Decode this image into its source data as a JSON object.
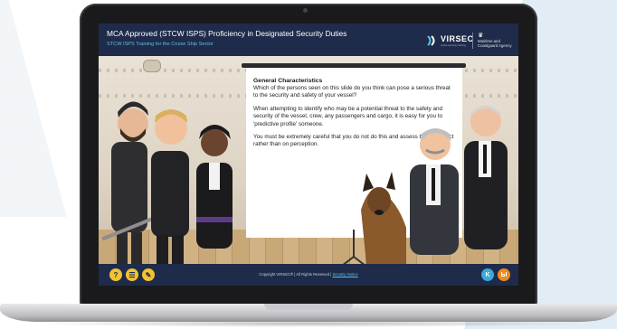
{
  "course": {
    "title": "MCA Approved (STCW ISPS) Proficiency in Designated Security Duties",
    "subtitle": "STCW ISPS Training for the Cruise Ship Sector"
  },
  "branding": {
    "logo_text": "VIRSEC",
    "logo_tagline": "online security training",
    "agency_text": "Maritime and Coastguard Agency"
  },
  "slide": {
    "heading": "General Characteristics",
    "paragraphs": [
      "Which of the persons seen on this slide do you think can pose a serious threat to the security and safety of your vessel?",
      "When attempting to identify who may be a potential threat to the safety and security of the vessel, crew, any passengers and cargo, it is easy for you to 'predictive profile' someone.",
      "You must be extremely careful that you do not do this and assess based on fact rather than on perception."
    ]
  },
  "footer": {
    "help_label": "?",
    "menu_label": "☰",
    "notes_label": "✎",
    "copyright": "Copyright VIRSEC® | All Rights Reserved |",
    "link": "Security Notice",
    "prev_label": "K",
    "next_label": "Ы"
  },
  "colors": {
    "navy": "#1e2b4a",
    "accent_blue": "#5cc3e8",
    "help_yellow": "#f2c230",
    "prev_blue": "#3aa9dc",
    "next_orange": "#f08a1c"
  }
}
